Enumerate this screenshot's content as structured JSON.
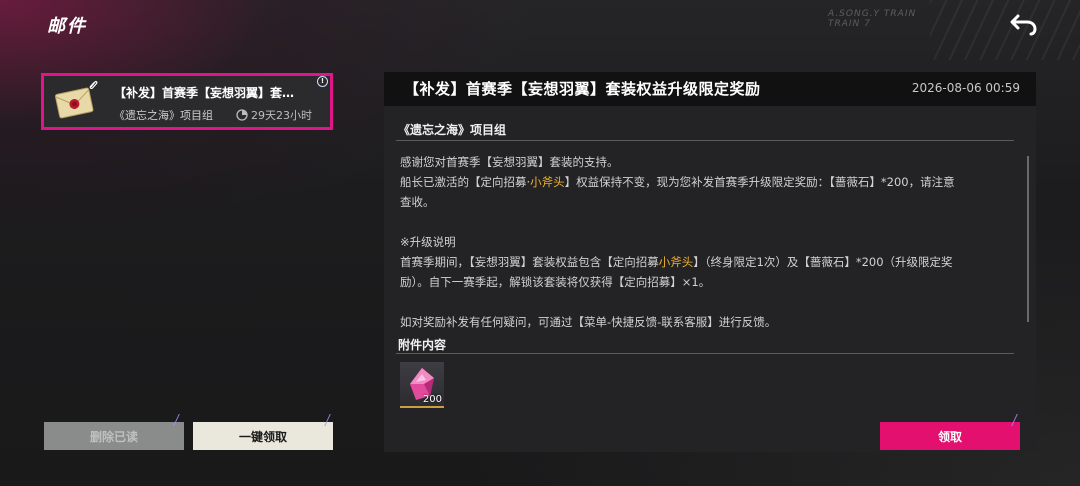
{
  "header": {
    "title": "邮件",
    "back_icon": "undo-arrow-icon",
    "deco_text": "A.SONG.Y TRAIN\nTRAIN 7"
  },
  "mail_list": [
    {
      "title": "【补发】首赛季【妄想羽翼】套…",
      "sender": "《遗忘之海》项目组",
      "timer": "29天23小时",
      "selected": true,
      "has_attachment": true,
      "alert_badge": "!"
    }
  ],
  "actions": {
    "delete_read_label": "删除已读",
    "claim_all_label": "一键领取",
    "claim_label": "领取"
  },
  "detail": {
    "title": "【补发】首赛季【妄想羽翼】套装权益升级限定奖励",
    "date": "2026-08-06 00:59",
    "sender": "《遗忘之海》项目组",
    "body": {
      "line1": "感谢您对首赛季【妄想羽翼】套装的支持。",
      "line2a": "船长已激活的【定向招募·",
      "line2b": "小斧头",
      "line2c": "】权益保持不变，现为您补发首赛季升级限定奖励：【蔷薇石】*200，请注意",
      "line3": "查收。",
      "line4": "※升级说明",
      "line5a": "首赛季期间，【妄想羽翼】套装权益包含【定向招募",
      "line5b": "小斧头",
      "line5c": "】（终身限定1次）及【蔷薇石】*200（升级限定奖",
      "line6": "励）。自下一赛季起，解锁该套装将仅获得【定向招募】×1。",
      "line7": "如对奖励补发有任何疑问，可通过【菜单-快捷反馈-联系客服】进行反馈。"
    },
    "attachments_heading": "附件内容",
    "attachments": [
      {
        "icon": "pink-crystal-icon",
        "quantity": "200"
      }
    ]
  },
  "colors": {
    "accent": "#e3106f",
    "highlight": "#f0b030"
  }
}
